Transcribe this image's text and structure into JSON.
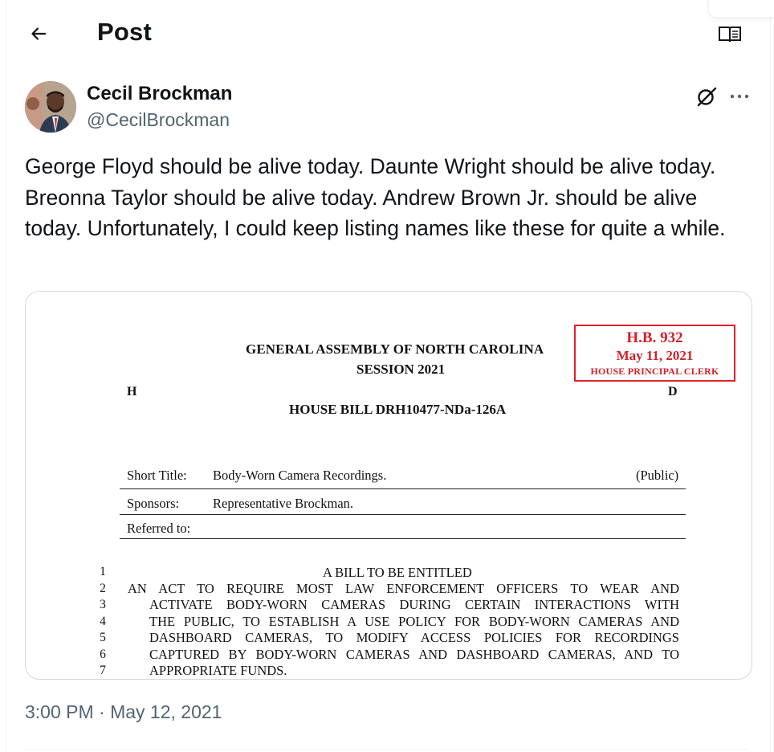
{
  "header": {
    "title": "Post",
    "back_icon": "arrow-left-icon",
    "reader_icon": "open-book-icon"
  },
  "author": {
    "name": "Cecil Brockman",
    "handle": "@CecilBrockman"
  },
  "tweet": {
    "text": "George Floyd should be alive today. Daunte Wright should be alive today. Breonna Taylor should be alive today. Andrew Brown Jr. should be alive today. Unfortunately, I could keep listing names like these for quite a while.",
    "timestamp": "3:00 PM · May 12, 2021"
  },
  "document": {
    "assembly": "GENERAL ASSEMBLY OF NORTH CAROLINA",
    "session": "SESSION 2021",
    "stamp": {
      "bill": "H.B. 932",
      "date": "May 11, 2021",
      "clerk": "HOUSE PRINCIPAL CLERK",
      "border_color": "#e5202a"
    },
    "chamber_left": "H",
    "chamber_right": "D",
    "bill_number": "HOUSE BILL DRH10477-NDa-126A",
    "short_title_label": "Short Title:",
    "short_title_value": "Body-Worn Camera Recordings.",
    "public_label": "(Public)",
    "sponsors_label": "Sponsors:",
    "sponsors_value": "Representative Brockman.",
    "referred_label": "Referred to:",
    "line_numbers": [
      "1",
      "2",
      "3",
      "4",
      "5",
      "6",
      "7"
    ],
    "lines": [
      "A BILL TO BE ENTITLED",
      "AN ACT TO REQUIRE MOST LAW ENFORCEMENT OFFICERS TO WEAR AND",
      "ACTIVATE BODY-WORN CAMERAS DURING CERTAIN INTERACTIONS WITH",
      "THE PUBLIC, TO ESTABLISH A USE POLICY FOR BODY-WORN CAMERAS AND",
      "DASHBOARD CAMERAS, TO MODIFY ACCESS POLICIES FOR RECORDINGS",
      "CAPTURED BY BODY-WORN CAMERAS AND DASHBOARD CAMERAS, AND TO",
      "APPROPRIATE FUNDS."
    ]
  },
  "colors": {
    "text_primary": "#0f1419",
    "text_secondary": "#536471",
    "border": "#cfd9de"
  }
}
